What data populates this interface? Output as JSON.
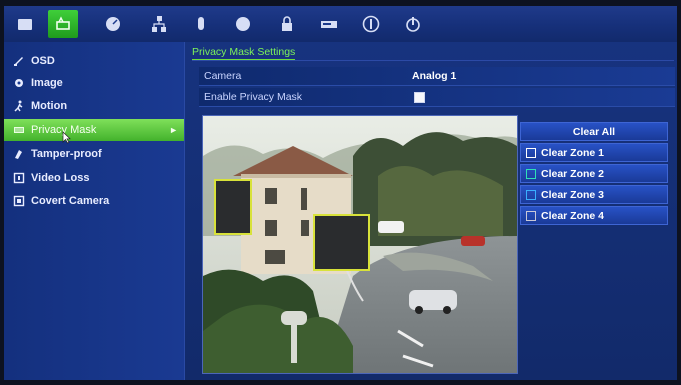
{
  "toolbar": {
    "icons": [
      "display-icon",
      "camera-icon",
      "recording-icon",
      "network-icon",
      "alarm-icon",
      "hdd-icon",
      "user-icon",
      "device-icon",
      "info-icon",
      "power-icon"
    ],
    "active": "camera-icon",
    "accent": "#3fcf3a"
  },
  "sidebar": {
    "items": [
      {
        "label": "OSD",
        "icon": "osd-icon"
      },
      {
        "label": "Image",
        "icon": "image-icon"
      },
      {
        "label": "Motion",
        "icon": "motion-icon"
      },
      {
        "label": "Privacy Mask",
        "icon": "privacy-mask-icon",
        "selected": true
      },
      {
        "label": "Tamper-proof",
        "icon": "tamper-icon"
      },
      {
        "label": "Video Loss",
        "icon": "video-loss-icon"
      },
      {
        "label": "Covert Camera",
        "icon": "covert-camera-icon"
      }
    ],
    "selected_color": "#5fcc3f"
  },
  "main": {
    "title": "Privacy Mask Settings",
    "camera_label": "Camera",
    "camera_value": "Analog 1",
    "enable_label": "Enable Privacy Mask",
    "enable_checked": true,
    "mask_color": "#d8e23a"
  },
  "zones": {
    "clear_all": "Clear All",
    "items": [
      {
        "label": "Clear Zone 1",
        "color": "#ffffff"
      },
      {
        "label": "Clear Zone 2",
        "color": "#2ee0b8"
      },
      {
        "label": "Clear Zone 3",
        "color": "#3ab0ff"
      },
      {
        "label": "Clear Zone 4",
        "color": "#c8c8d8"
      }
    ]
  }
}
